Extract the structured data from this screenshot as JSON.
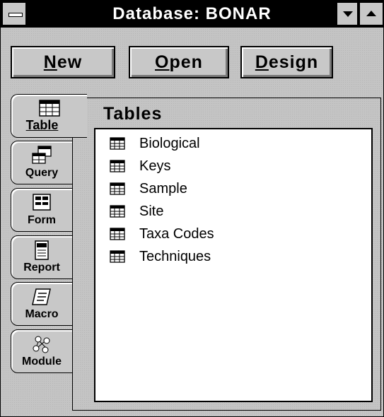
{
  "window": {
    "title": "Database: BONAR"
  },
  "toolbar": {
    "new_label": "New",
    "open_label": "Open",
    "design_label": "Design"
  },
  "tabs": [
    {
      "label": "Table",
      "icon": "table-icon",
      "active": true
    },
    {
      "label": "Query",
      "icon": "query-icon"
    },
    {
      "label": "Form",
      "icon": "form-icon"
    },
    {
      "label": "Report",
      "icon": "report-icon"
    },
    {
      "label": "Macro",
      "icon": "macro-icon"
    },
    {
      "label": "Module",
      "icon": "module-icon"
    }
  ],
  "panel": {
    "title": "Tables",
    "items": [
      {
        "label": "Biological",
        "icon": "table-icon"
      },
      {
        "label": "Keys",
        "icon": "table-icon"
      },
      {
        "label": "Sample",
        "icon": "table-icon"
      },
      {
        "label": "Site",
        "icon": "table-icon"
      },
      {
        "label": "Taxa Codes",
        "icon": "table-icon"
      },
      {
        "label": "Techniques",
        "icon": "table-icon"
      }
    ]
  }
}
